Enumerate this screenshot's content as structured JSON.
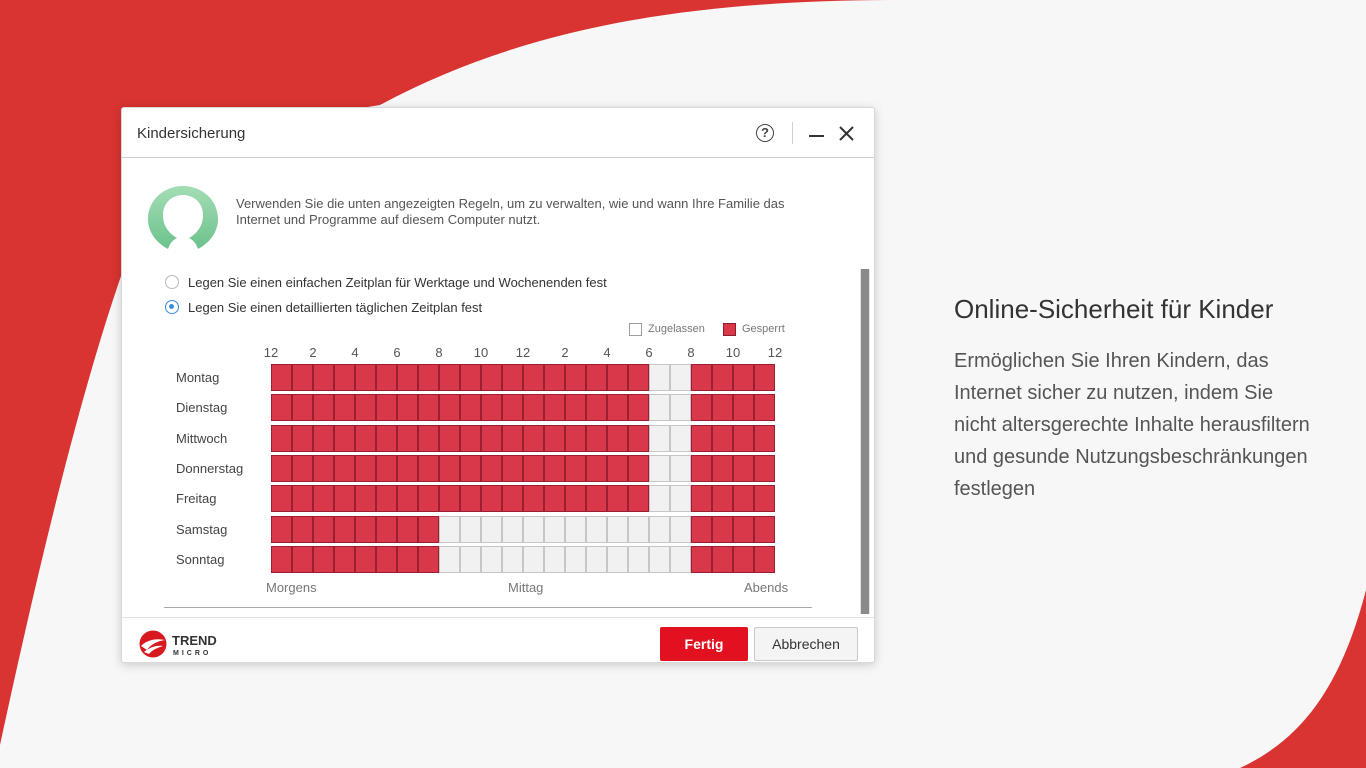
{
  "colors": {
    "background_red": "#d93431",
    "background_light": "#f7f7f7",
    "blocked": "#d9384a",
    "allowed": "#f1f1f1",
    "primary_button": "#e1111f",
    "radio_selected": "#3a8ee0"
  },
  "dialog": {
    "title": "Kindersicherung",
    "help_icon": "?",
    "avatar_icon": "child-profile-icon",
    "intro_text": "Verwenden Sie die unten angezeigten Regeln, um zu verwalten, wie und wann Ihre Familie das Internet und Programme auf diesem Computer nutzt.",
    "options": [
      {
        "label": "Legen Sie einen einfachen Zeitplan für Werktage und Wochenenden fest",
        "selected": false
      },
      {
        "label": "Legen Sie einen detaillierten täglichen Zeitplan fest",
        "selected": true
      }
    ],
    "legend": {
      "allowed": "Zugelassen",
      "blocked": "Gesperrt"
    },
    "schedule": {
      "hour_labels": [
        "12",
        "2",
        "4",
        "6",
        "8",
        "10",
        "12",
        "2",
        "4",
        "6",
        "8",
        "10",
        "12"
      ],
      "days": [
        {
          "name": "Montag",
          "allowed_hours": [
            18,
            19
          ]
        },
        {
          "name": "Dienstag",
          "allowed_hours": [
            18,
            19
          ]
        },
        {
          "name": "Mittwoch",
          "allowed_hours": [
            18,
            19
          ]
        },
        {
          "name": "Donnerstag",
          "allowed_hours": [
            18,
            19
          ]
        },
        {
          "name": "Freitag",
          "allowed_hours": [
            18,
            19
          ]
        },
        {
          "name": "Samstag",
          "allowed_hours": [
            8,
            9,
            10,
            11,
            12,
            13,
            14,
            15,
            16,
            17,
            18,
            19
          ]
        },
        {
          "name": "Sonntag",
          "allowed_hours": [
            8,
            9,
            10,
            11,
            12,
            13,
            14,
            15,
            16,
            17,
            18,
            19
          ]
        }
      ],
      "dayparts": {
        "morning": "Morgens",
        "noon": "Mittag",
        "evening": "Abends"
      }
    },
    "logo": {
      "line1": "TREND",
      "line2": "MICRO"
    },
    "buttons": {
      "done": "Fertig",
      "cancel": "Abbrechen"
    }
  },
  "promo": {
    "title": "Online-Sicherheit für Kinder",
    "text": "Ermöglichen Sie Ihren Kindern, das Internet sicher zu nutzen, indem Sie nicht altersgerechte Inhalte herausfiltern und gesunde Nutzungsbeschränkungen festlegen"
  }
}
